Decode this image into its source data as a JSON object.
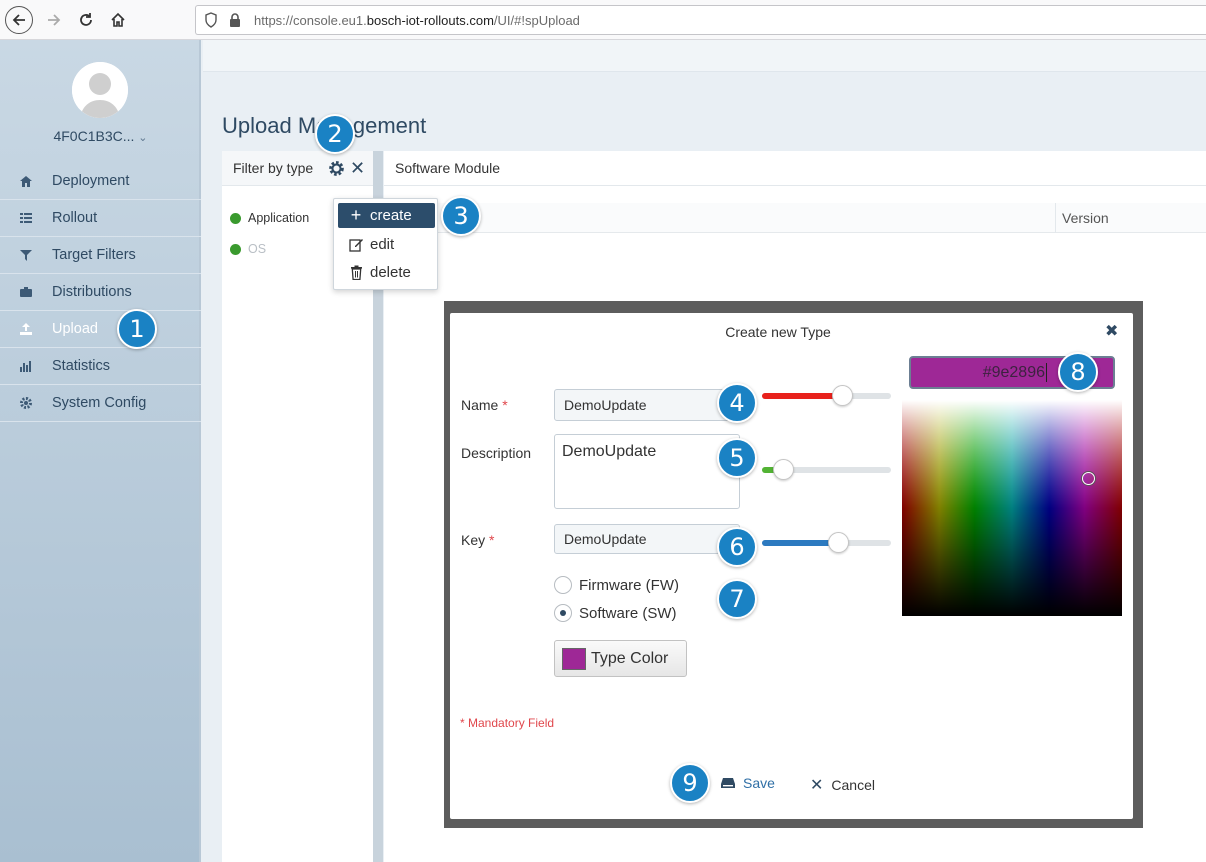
{
  "browser": {
    "url_prefix": "https://console.eu1.",
    "url_host": "bosch-iot-rollouts.com",
    "url_suffix": "/UI/#!spUpload"
  },
  "sidebar": {
    "user": "4F0C1B3C...",
    "items": [
      {
        "label": "Deployment",
        "icon": "home-icon",
        "active": false
      },
      {
        "label": "Rollout",
        "icon": "list-icon",
        "active": false
      },
      {
        "label": "Target Filters",
        "icon": "filter-icon",
        "active": false
      },
      {
        "label": "Distributions",
        "icon": "briefcase-icon",
        "active": false
      },
      {
        "label": "Upload",
        "icon": "upload-icon",
        "active": true
      },
      {
        "label": "Statistics",
        "icon": "bar-chart-icon",
        "active": false
      },
      {
        "label": "System Config",
        "icon": "gear-icon",
        "active": false
      }
    ]
  },
  "page": {
    "title": "Upload Management"
  },
  "filter": {
    "title": "Filter by type",
    "types": [
      {
        "label": "Application",
        "dim": false
      },
      {
        "label": "OS",
        "dim": true
      }
    ]
  },
  "software_module": {
    "title": "Software Module",
    "col_version": "Version"
  },
  "menu": {
    "create": "create",
    "edit": "edit",
    "delete": "delete"
  },
  "modal": {
    "title": "Create new Type",
    "name_label": "Name",
    "name_value": "DemoUpdate",
    "description_label": "Description",
    "description_value": "DemoUpdate",
    "key_label": "Key",
    "key_value": "DemoUpdate",
    "required_mark": "*",
    "radio_fw": "Firmware (FW)",
    "radio_sw": "Software (SW)",
    "type_color_label": "Type Color",
    "mandatory_note": "* Mandatory Field",
    "save_label": "Save",
    "cancel_label": "Cancel",
    "hex_value": "#9e2896",
    "color": "#9e2896",
    "sliders": {
      "red": {
        "color": "#e8211c",
        "value": 0.62
      },
      "green": {
        "color": "#52b334",
        "value": 0.16
      },
      "blue": {
        "color": "#2c7ac0",
        "value": 0.59
      }
    }
  },
  "badges": [
    "1",
    "2",
    "3",
    "4",
    "5",
    "6",
    "7",
    "8",
    "9"
  ]
}
